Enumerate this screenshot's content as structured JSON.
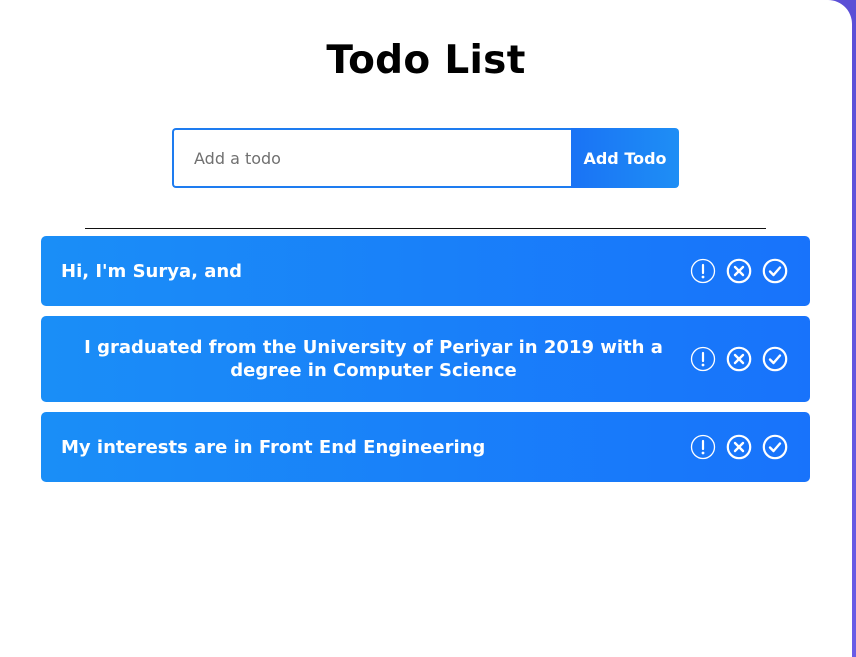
{
  "app": {
    "title": "Todo List"
  },
  "form": {
    "placeholder": "Add a todo",
    "value": "",
    "add_button_label": "Add Todo"
  },
  "todos": [
    {
      "text": "Hi, I'm Surya, and"
    },
    {
      "text": "I graduated from the University of Periyar in 2019 with a degree in Computer Science"
    },
    {
      "text": "My interests are in Front End Engineering"
    }
  ],
  "icons": {
    "priority": "exclamation-circle-icon",
    "remove": "x-circle-icon",
    "complete": "check-circle-icon"
  },
  "colors": {
    "accent": "#1a73f5",
    "row_start": "#1a8ef7",
    "row_end": "#1873fb",
    "background_edge": "#5b4fd6"
  }
}
